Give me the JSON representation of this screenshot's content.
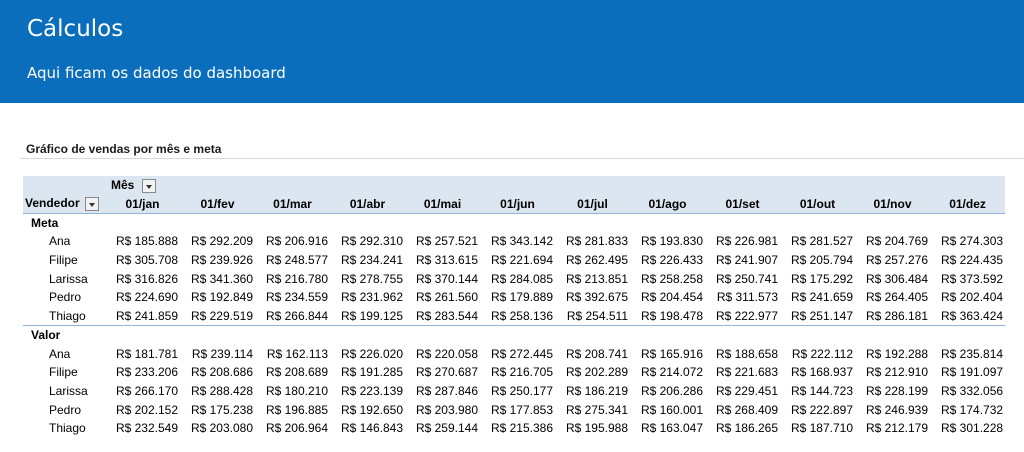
{
  "header": {
    "title": "Cálculos",
    "subtitle": "Aqui ficam os dados do dashboard"
  },
  "section": {
    "title": "Gráfico de vendas por mês e meta"
  },
  "pivot": {
    "column_field": "Mês",
    "row_field": "Vendedor",
    "months": [
      "01/jan",
      "01/fev",
      "01/mar",
      "01/abr",
      "01/mai",
      "01/jun",
      "01/jul",
      "01/ago",
      "01/set",
      "01/out",
      "01/nov",
      "01/dez"
    ],
    "groups": [
      {
        "label": "Meta",
        "rows": [
          {
            "name": "Ana",
            "values": [
              "R$ 185.888",
              "R$ 292.209",
              "R$ 206.916",
              "R$ 292.310",
              "R$ 257.521",
              "R$ 343.142",
              "R$ 281.833",
              "R$ 193.830",
              "R$ 226.981",
              "R$ 281.527",
              "R$ 204.769",
              "R$ 274.303"
            ]
          },
          {
            "name": "Filipe",
            "values": [
              "R$ 305.708",
              "R$ 239.926",
              "R$ 248.577",
              "R$ 234.241",
              "R$ 313.615",
              "R$ 221.694",
              "R$ 262.495",
              "R$ 226.433",
              "R$ 241.907",
              "R$ 205.794",
              "R$ 257.276",
              "R$ 224.435"
            ]
          },
          {
            "name": "Larissa",
            "values": [
              "R$ 316.826",
              "R$ 341.360",
              "R$ 216.780",
              "R$ 278.755",
              "R$ 370.144",
              "R$ 284.085",
              "R$ 213.851",
              "R$ 258.258",
              "R$ 250.741",
              "R$ 175.292",
              "R$ 306.484",
              "R$ 373.592"
            ]
          },
          {
            "name": "Pedro",
            "values": [
              "R$ 224.690",
              "R$ 192.849",
              "R$ 234.559",
              "R$ 231.962",
              "R$ 261.560",
              "R$ 179.889",
              "R$ 392.675",
              "R$ 204.454",
              "R$ 311.573",
              "R$ 241.659",
              "R$ 264.405",
              "R$ 202.404"
            ]
          },
          {
            "name": "Thiago",
            "values": [
              "R$ 241.859",
              "R$ 229.519",
              "R$ 266.844",
              "R$ 199.125",
              "R$ 283.544",
              "R$ 258.136",
              "R$ 254.511",
              "R$ 198.478",
              "R$ 222.977",
              "R$ 251.147",
              "R$ 286.181",
              "R$ 363.424"
            ]
          }
        ]
      },
      {
        "label": "Valor",
        "rows": [
          {
            "name": "Ana",
            "values": [
              "R$ 181.781",
              "R$ 239.114",
              "R$ 162.113",
              "R$ 226.020",
              "R$ 220.058",
              "R$ 272.445",
              "R$ 208.741",
              "R$ 165.916",
              "R$ 188.658",
              "R$ 222.112",
              "R$ 192.288",
              "R$ 235.814"
            ]
          },
          {
            "name": "Filipe",
            "values": [
              "R$ 233.206",
              "R$ 208.686",
              "R$ 208.689",
              "R$ 191.285",
              "R$ 270.687",
              "R$ 216.705",
              "R$ 202.289",
              "R$ 214.072",
              "R$ 221.683",
              "R$ 168.937",
              "R$ 212.910",
              "R$ 191.097"
            ]
          },
          {
            "name": "Larissa",
            "values": [
              "R$ 266.170",
              "R$ 288.428",
              "R$ 180.210",
              "R$ 223.139",
              "R$ 287.846",
              "R$ 250.177",
              "R$ 186.219",
              "R$ 206.286",
              "R$ 229.451",
              "R$ 144.723",
              "R$ 228.199",
              "R$ 332.056"
            ]
          },
          {
            "name": "Pedro",
            "values": [
              "R$ 202.152",
              "R$ 175.238",
              "R$ 196.885",
              "R$ 192.650",
              "R$ 203.980",
              "R$ 177.853",
              "R$ 275.341",
              "R$ 160.001",
              "R$ 268.409",
              "R$ 222.897",
              "R$ 246.939",
              "R$ 174.732"
            ]
          },
          {
            "name": "Thiago",
            "values": [
              "R$ 232.549",
              "R$ 203.080",
              "R$ 206.964",
              "R$ 146.843",
              "R$ 259.144",
              "R$ 215.386",
              "R$ 195.988",
              "R$ 163.047",
              "R$ 186.265",
              "R$ 187.710",
              "R$ 212.179",
              "R$ 301.228"
            ]
          }
        ]
      }
    ]
  }
}
